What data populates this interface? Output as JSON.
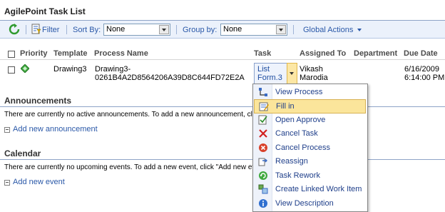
{
  "page": {
    "title": "AgilePoint Task List"
  },
  "toolbar": {
    "filter_label": "Filter",
    "sort_by_label": "Sort By:",
    "sort_by_value": "None",
    "group_by_label": "Group by:",
    "group_by_value": "None",
    "global_actions_label": "Global Actions"
  },
  "table": {
    "headers": {
      "priority": "Priority",
      "template": "Template",
      "process_name": "Process Name",
      "task": "Task",
      "assigned_to": "Assigned To",
      "department": "Department",
      "due_date": "Due Date"
    },
    "row": {
      "template": "Drawing3",
      "process_name_line1": "Drawing3-",
      "process_name_line2": "0261B4A2D8564206A39D8C644FD72E2A",
      "task_line1": "List",
      "task_line2": "Form.3",
      "assigned_line1": "Vikash",
      "assigned_line2": "Marodia",
      "due_line1": "6/16/2009",
      "due_line2": "6:14:00 PM"
    }
  },
  "announcements": {
    "title": "Announcements",
    "body": "There are currently no active announcements. To add a new announcement, click",
    "add_link": "Add new announcement"
  },
  "calendar": {
    "title": "Calendar",
    "body": "There are currently no upcoming events. To add a new event, click \"Add new eve",
    "add_link": "Add new event"
  },
  "context_menu": {
    "items": [
      {
        "label": "View Process",
        "icon": "view-process-icon"
      },
      {
        "label": "Fill in",
        "icon": "fill-in-icon",
        "highlighted": true
      },
      {
        "label": "Open Approve",
        "icon": "open-approve-icon"
      },
      {
        "label": "Cancel Task",
        "icon": "cancel-task-icon"
      },
      {
        "label": "Cancel Process",
        "icon": "cancel-process-icon"
      },
      {
        "label": "Reassign",
        "icon": "reassign-icon"
      },
      {
        "label": "Task Rework",
        "icon": "task-rework-icon"
      },
      {
        "label": "Create Linked Work Item",
        "icon": "linked-work-item-icon"
      },
      {
        "label": "View Description",
        "icon": "info-icon"
      }
    ]
  },
  "colors": {
    "link": "#2a58a8",
    "toolbar_bg": "#ebf1fb",
    "menu_highlight": "#fbe59b"
  }
}
